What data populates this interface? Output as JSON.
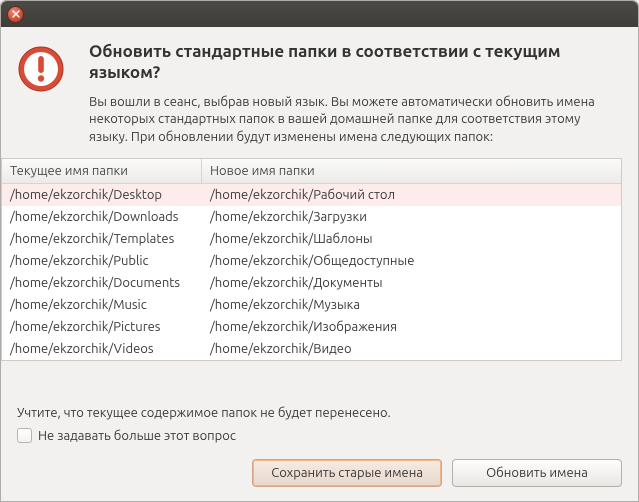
{
  "titlebar": {
    "empty": ""
  },
  "dialog": {
    "heading": "Обновить стандартные папки в соответствии с текущим языком?",
    "description": "Вы вошли в сеанс, выбрав новый язык. Вы можете автоматически обновить имена некоторых стандартных папок в вашей домашней папке для соответствия этому языку. При обновлении будут изменены имена следующих папок:"
  },
  "table": {
    "headers": {
      "current": "Текущее имя папки",
      "new": "Новое имя папки"
    },
    "rows": [
      {
        "current": "/home/ekzorchik/Desktop",
        "new": "/home/ekzorchik/Рабочий стол",
        "selected": true
      },
      {
        "current": "/home/ekzorchik/Downloads",
        "new": "/home/ekzorchik/Загрузки"
      },
      {
        "current": "/home/ekzorchik/Templates",
        "new": "/home/ekzorchik/Шаблоны"
      },
      {
        "current": "/home/ekzorchik/Public",
        "new": "/home/ekzorchik/Общедоступные"
      },
      {
        "current": "/home/ekzorchik/Documents",
        "new": "/home/ekzorchik/Документы"
      },
      {
        "current": "/home/ekzorchik/Music",
        "new": "/home/ekzorchik/Музыка"
      },
      {
        "current": "/home/ekzorchik/Pictures",
        "new": "/home/ekzorchik/Изображения"
      },
      {
        "current": "/home/ekzorchik/Videos",
        "new": "/home/ekzorchik/Видео"
      }
    ]
  },
  "footnote": "Учтите, что текущее содержимое папок не будет перенесено.",
  "checkbox": {
    "label": "Не задавать больше этот вопрос",
    "checked": false
  },
  "buttons": {
    "keep": "Сохранить старые имена",
    "update": "Обновить имена"
  }
}
